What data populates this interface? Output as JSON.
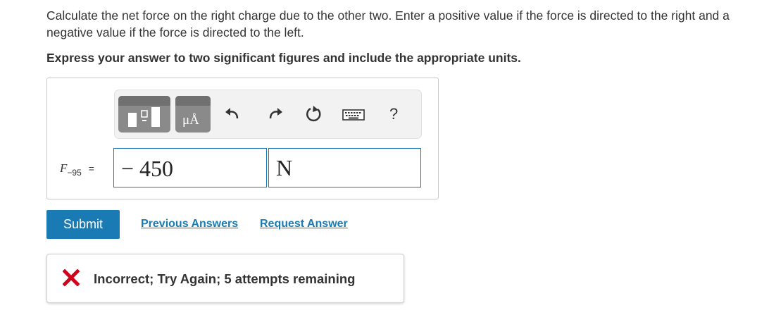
{
  "question": {
    "prompt": "Calculate the net force on the right charge due to the other two. Enter a positive value if the force is directed to the right and a negative value if the force is directed to the left.",
    "instruction": "Express your answer to two significant figures and include the appropriate units."
  },
  "toolbar": {
    "units_label": "μÅ",
    "help_label": "?"
  },
  "answer": {
    "variable": "F",
    "subscript": "−95",
    "equals": "=",
    "value": "− 450",
    "unit": "N"
  },
  "actions": {
    "submit_label": "Submit",
    "previous_answers_label": "Previous Answers",
    "request_answer_label": "Request Answer"
  },
  "feedback": {
    "message": "Incorrect; Try Again; 5 attempts remaining",
    "status_color": "#d0021b"
  },
  "colors": {
    "accent": "#1a7bb4",
    "toolbar_button": "#8a8a8a"
  }
}
